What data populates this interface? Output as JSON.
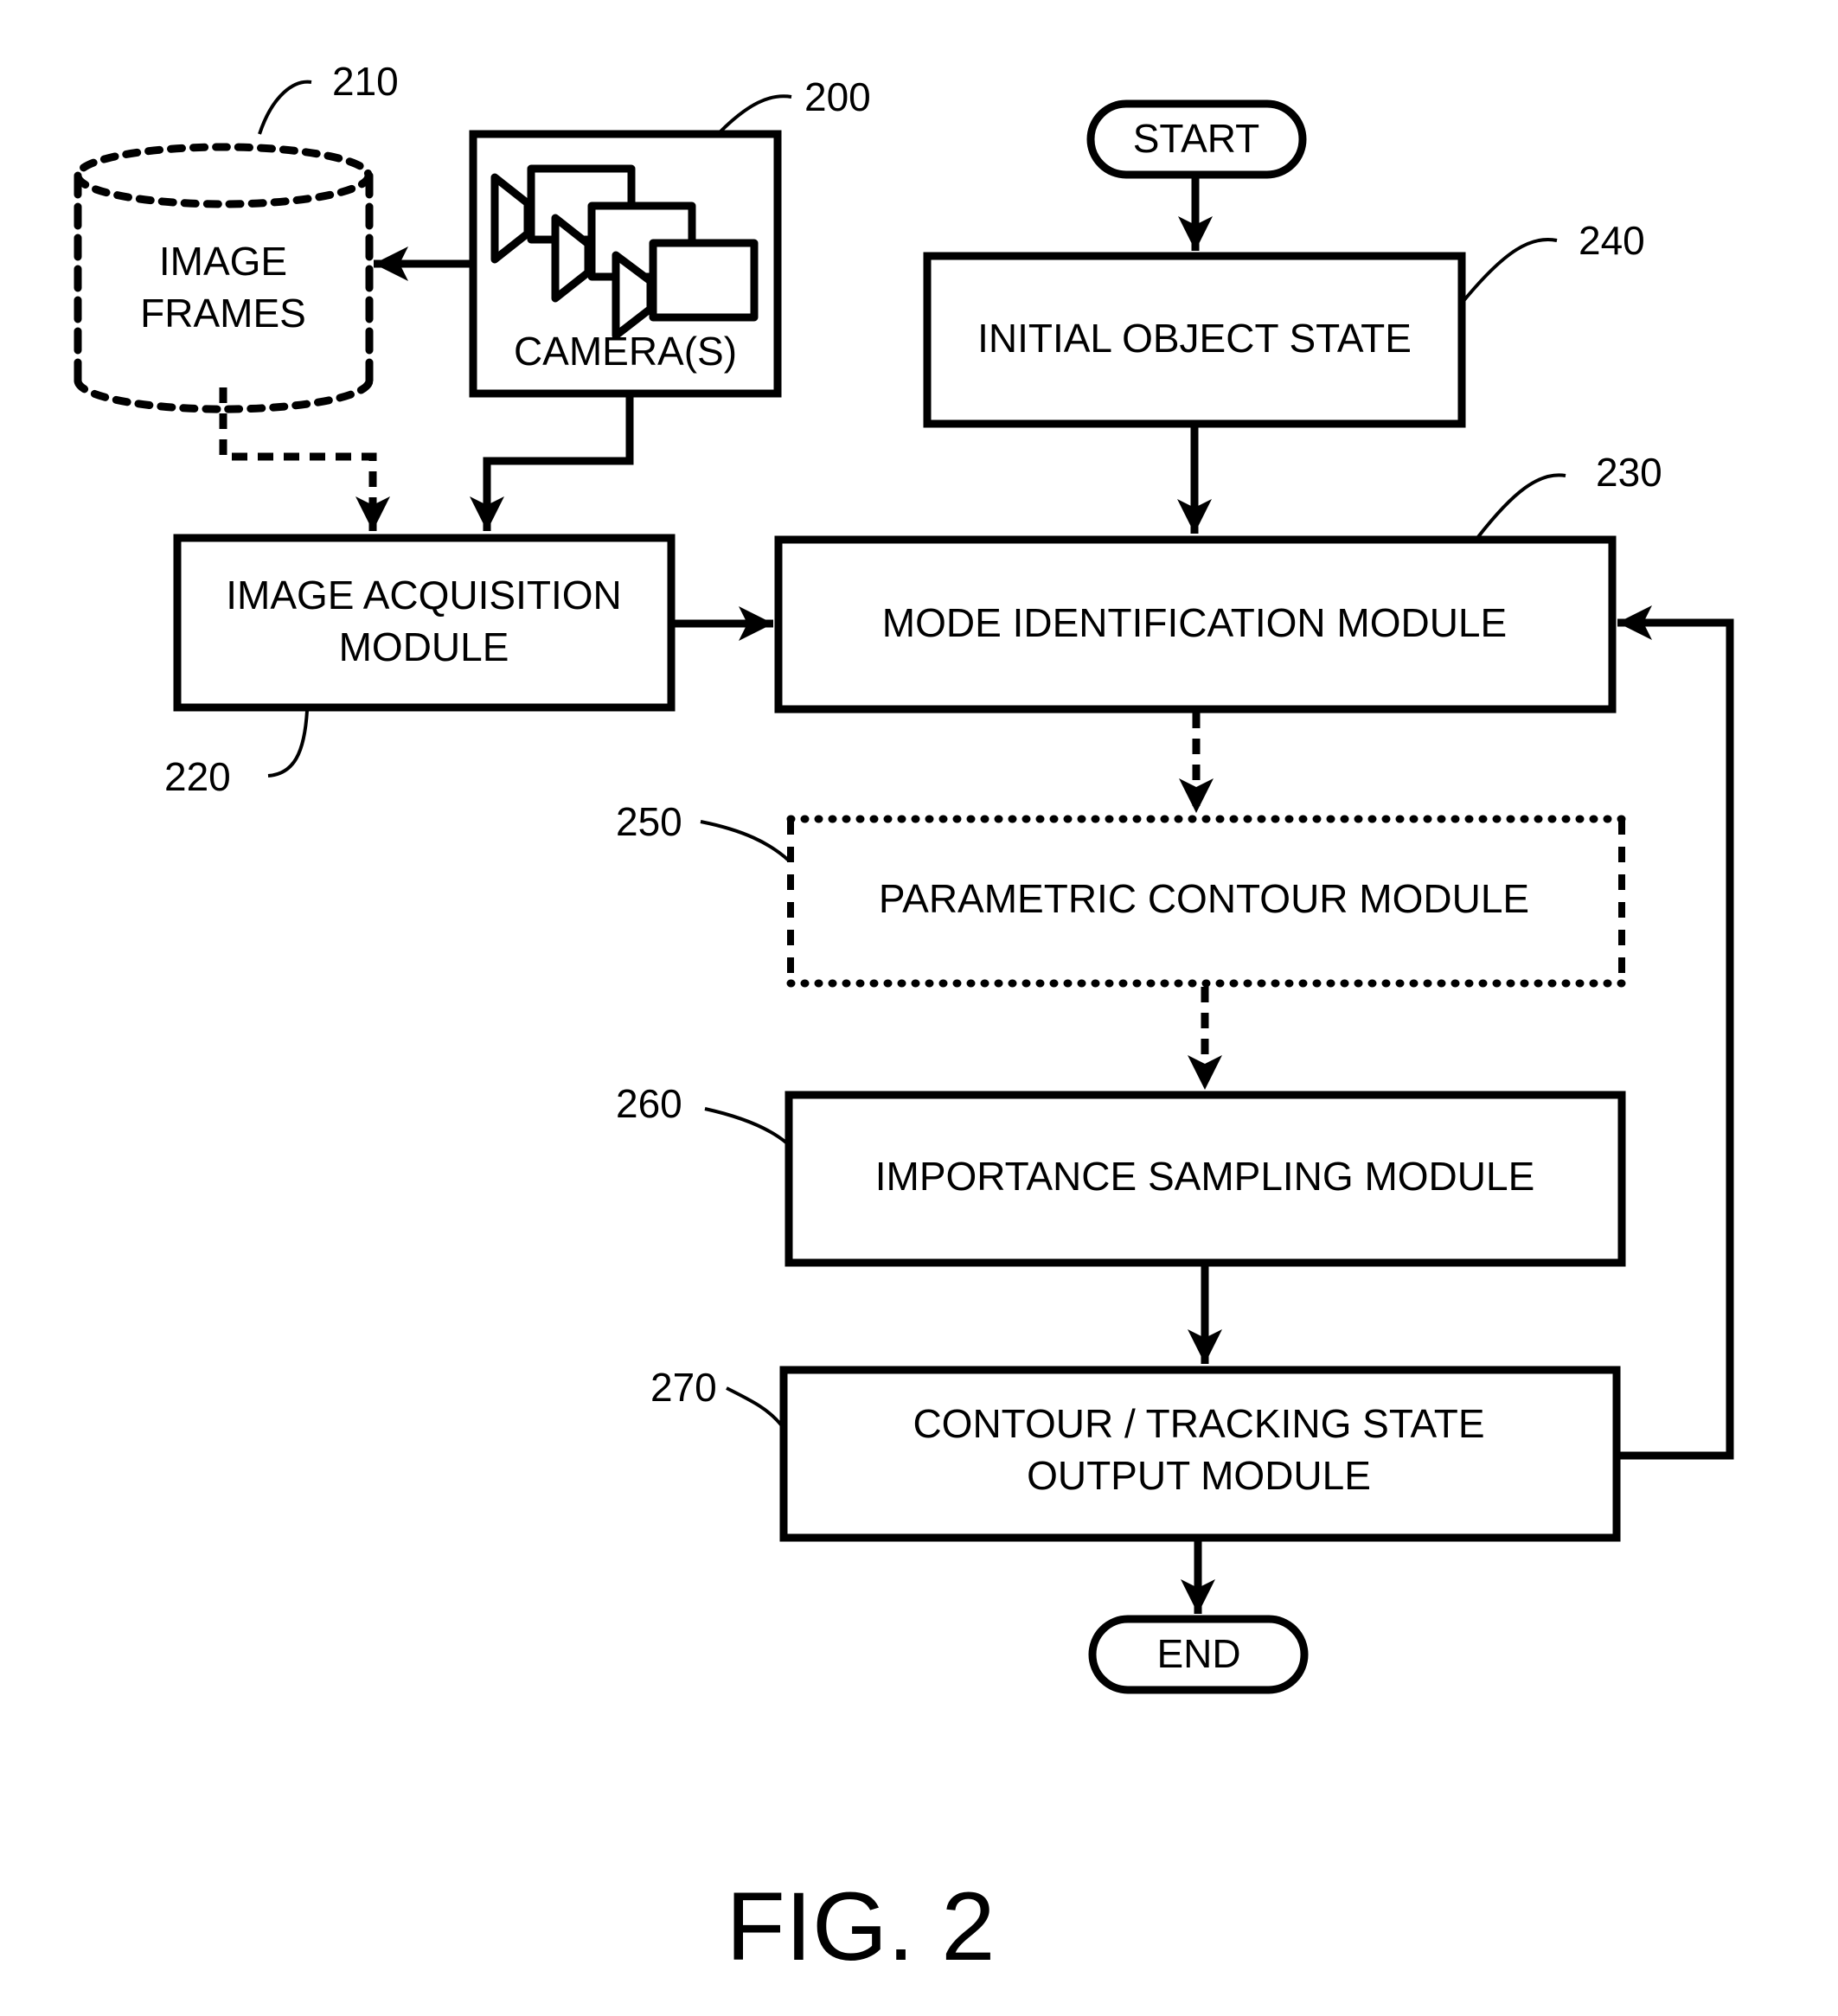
{
  "figure_label": "FIG. 2",
  "colors": {
    "ink": "#000000",
    "background": "#ffffff"
  },
  "nodes": {
    "start": {
      "label": "START",
      "shape": "terminator"
    },
    "image_frames": {
      "ref": "210",
      "lines": [
        "IMAGE",
        "FRAMES"
      ],
      "shape": "database-cylinder",
      "style": "dashed"
    },
    "cameras": {
      "ref": "200",
      "label": "CAMERA(S)",
      "icon": "video-camera-stack-icon"
    },
    "initial_object_state": {
      "ref": "240",
      "label": "INITIAL OBJECT STATE"
    },
    "image_acquisition": {
      "ref": "220",
      "lines": [
        "IMAGE ACQUISITION",
        "MODULE"
      ]
    },
    "mode_identification": {
      "ref": "230",
      "label": "MODE IDENTIFICATION MODULE"
    },
    "parametric_contour": {
      "ref": "250",
      "label": "PARAMETRIC CONTOUR MODULE",
      "style": "dashed"
    },
    "importance_sampling": {
      "ref": "260",
      "label": "IMPORTANCE SAMPLING MODULE"
    },
    "contour_output": {
      "ref": "270",
      "lines": [
        "CONTOUR / TRACKING STATE",
        "OUTPUT MODULE"
      ]
    },
    "end": {
      "label": "END",
      "shape": "terminator"
    }
  },
  "edges": [
    {
      "from": "cameras",
      "to": "image_frames",
      "style": "solid"
    },
    {
      "from": "image_frames",
      "to": "image_acquisition",
      "style": "dashed"
    },
    {
      "from": "cameras",
      "to": "image_acquisition",
      "style": "solid"
    },
    {
      "from": "start",
      "to": "initial_object_state",
      "style": "solid"
    },
    {
      "from": "initial_object_state",
      "to": "mode_identification",
      "style": "solid"
    },
    {
      "from": "image_acquisition",
      "to": "mode_identification",
      "style": "solid"
    },
    {
      "from": "mode_identification",
      "to": "parametric_contour",
      "style": "dashed"
    },
    {
      "from": "parametric_contour",
      "to": "importance_sampling",
      "style": "dashed"
    },
    {
      "from": "importance_sampling",
      "to": "contour_output",
      "style": "solid"
    },
    {
      "from": "contour_output",
      "to": "mode_identification",
      "style": "solid",
      "kind": "feedback-loop"
    },
    {
      "from": "contour_output",
      "to": "end",
      "style": "solid"
    }
  ]
}
